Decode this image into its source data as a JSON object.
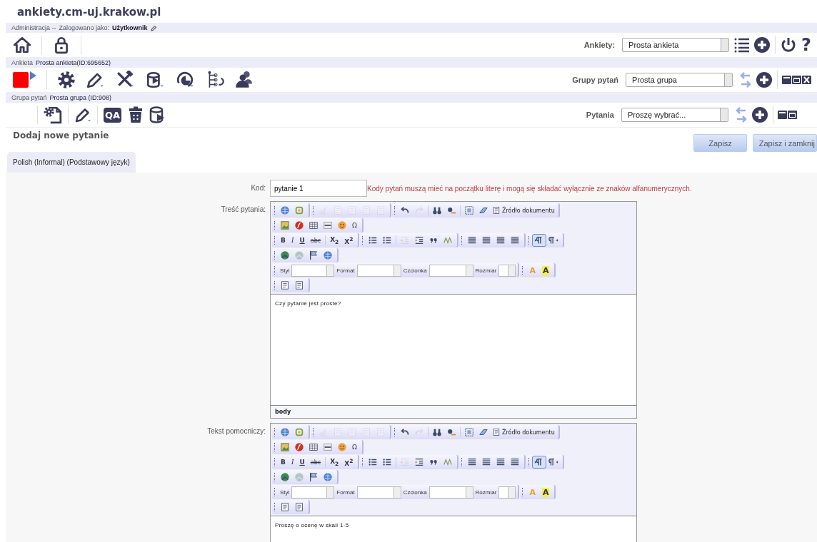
{
  "site_title": "ankiety.cm-uj.krakow.pl",
  "admin_bar": {
    "section": "Administracja --",
    "logged_as_label": "Zalogowano jako:",
    "user": "Użytkownik"
  },
  "main_toolbar": {
    "label": "Ankiety:",
    "select_value": "Prosta ankieta",
    "help": "?"
  },
  "survey_bar": {
    "label": "Ankieta",
    "value": "Prosta ankieta(ID:695652)"
  },
  "survey_toolbar": {
    "label": "Grupy pytań",
    "select_value": "Prosta grupa"
  },
  "group_bar": {
    "label": "Grupa pytań",
    "value": "Prosta grupa (ID:908)"
  },
  "group_toolbar": {
    "qa": "QA",
    "label": "Pytania",
    "select_value": "Proszę wybrać..."
  },
  "page_title": "Dodaj nowe pytanie",
  "buttons": [
    "Zapisz",
    "Zapisz i zamknij"
  ],
  "tabs": [
    {
      "label": "Polish (Informal) (Podstawowy język)",
      "selected": true
    }
  ],
  "form": {
    "code": {
      "label": "Kod:",
      "value": "pytanie 1",
      "error": "Kody pytań muszą mieć na początku literę i mogą się składać wyłącznie ze znaków alfanumerycznych."
    },
    "editors": [
      {
        "label": "Treść pytania:",
        "content": "Czy pytanie jest proste?",
        "path": "body",
        "toolbar": [
          [
            [
              {
                "kind": "icon",
                "disabled": false,
                "active": false
              },
              {
                "kind": "icon",
                "disabled": false,
                "active": false
              }
            ],
            [
              {
                "kind": "icon",
                "disabled": true,
                "active": false
              },
              {
                "kind": "icon",
                "disabled": true,
                "active": false
              },
              {
                "kind": "icon",
                "disabled": true,
                "active": false
              },
              {
                "kind": "icon",
                "disabled": true,
                "active": false
              },
              {
                "kind": "icon",
                "disabled": true,
                "active": false
              }
            ],
            [
              {
                "kind": "icon",
                "disabled": false,
                "active": false
              },
              {
                "kind": "icon",
                "disabled": true,
                "active": false
              },
              {
                "kind": "separator"
              },
              {
                "kind": "icon",
                "disabled": false,
                "active": false
              },
              {
                "kind": "icon",
                "disabled": false,
                "active": false
              },
              {
                "kind": "separator"
              },
              {
                "kind": "icon",
                "disabled": false,
                "active": false
              },
              {
                "kind": "icon",
                "disabled": false,
                "active": false
              },
              {
                "kind": "source",
                "label": "Źródło dokumentu"
              }
            ]
          ],
          [
            [
              {
                "kind": "icon",
                "disabled": false,
                "active": false
              },
              {
                "kind": "icon",
                "disabled": false,
                "active": false
              },
              {
                "kind": "icon",
                "disabled": false,
                "active": false
              },
              {
                "kind": "icon",
                "disabled": false,
                "active": false
              },
              {
                "kind": "icon",
                "disabled": false,
                "active": false
              },
              {
                "kind": "symbol",
                "label": "Ω"
              }
            ]
          ],
          [
            [
              {
                "kind": "bold",
                "label": "B"
              },
              {
                "kind": "italic",
                "label": "I"
              },
              {
                "kind": "underline",
                "label": "U"
              },
              {
                "kind": "strike",
                "label": "abc"
              },
              {
                "kind": "separator"
              },
              {
                "kind": "bold",
                "label": "X$_{2}$"
              },
              {
                "kind": "bold",
                "label": "X$^{2}$"
              }
            ],
            [
              {
                "kind": "icon",
                "disabled": false,
                "active": false
              },
              {
                "kind": "icon",
                "disabled": false,
                "active": false
              },
              {
                "kind": "separator"
              },
              {
                "kind": "icon",
                "disabled": true,
                "active": false
              },
              {
                "kind": "icon",
                "disabled": false,
                "active": false
              },
              {
                "kind": "icon",
                "disabled": false,
                "active": false
              },
              {
                "kind": "icon",
                "disabled": false,
                "active": false
              }
            ],
            [
              {
                "kind": "icon",
                "disabled": false,
                "active": false
              },
              {
                "kind": "icon",
                "disabled": false,
                "active": false
              },
              {
                "kind": "icon",
                "disabled": false,
                "active": false
              },
              {
                "kind": "icon",
                "disabled": false,
                "active": false
              }
            ],
            [
              {
                "kind": "icon",
                "disabled": false,
                "active": true
              },
              {
                "kind": "icon",
                "disabled": false,
                "active": false
              }
            ]
          ],
          [
            [
              {
                "kind": "icon",
                "disabled": false,
                "active": false
              },
              {
                "kind": "icon",
                "disabled": true,
                "active": false
              },
              {
                "kind": "icon",
                "disabled": false,
                "active": false
              },
              {
                "kind": "icon",
                "disabled": false,
                "active": false
              }
            ]
          ],
          [
            [
              {
                "kind": "select",
                "label": "Styl"
              },
              {
                "kind": "select",
                "label": "Format"
              },
              {
                "kind": "select",
                "label": "Czcionka"
              },
              {
                "kind": "select",
                "label": "Rozmiar"
              }
            ],
            [
              {
                "kind": "color",
                "label": "A",
                "highlight": false
              },
              {
                "kind": "color",
                "label": "A",
                "highlight": true
              }
            ]
          ],
          [
            [
              {
                "kind": "icon",
                "disabled": false,
                "active": false
              },
              {
                "kind": "icon",
                "disabled": false,
                "active": false
              }
            ]
          ]
        ]
      },
      {
        "label": "Tekst pomocniczy:",
        "content": "Proszę o ocenę w skali 1-5",
        "toolbar": [
          [
            [
              {
                "kind": "icon",
                "disabled": false,
                "active": false
              },
              {
                "kind": "icon",
                "disabled": false,
                "active": false
              }
            ],
            [
              {
                "kind": "icon",
                "disabled": true,
                "active": false
              },
              {
                "kind": "icon",
                "disabled": true,
                "active": false
              },
              {
                "kind": "icon",
                "disabled": true,
                "active": false
              },
              {
                "kind": "icon",
                "disabled": true,
                "active": false
              },
              {
                "kind": "icon",
                "disabled": true,
                "active": false
              }
            ],
            [
              {
                "kind": "icon",
                "disabled": false,
                "active": false
              },
              {
                "kind": "icon",
                "disabled": true,
                "active": false
              },
              {
                "kind": "separator"
              },
              {
                "kind": "icon",
                "disabled": false,
                "active": false
              },
              {
                "kind": "icon",
                "disabled": false,
                "active": false
              },
              {
                "kind": "separator"
              },
              {
                "kind": "icon",
                "disabled": false,
                "active": false
              },
              {
                "kind": "icon",
                "disabled": false,
                "active": false
              },
              {
                "kind": "source",
                "label": "Źródło dokumentu"
              }
            ]
          ],
          [
            [
              {
                "kind": "icon",
                "disabled": false,
                "active": false
              },
              {
                "kind": "icon",
                "disabled": false,
                "active": false
              },
              {
                "kind": "icon",
                "disabled": false,
                "active": false
              },
              {
                "kind": "icon",
                "disabled": false,
                "active": false
              },
              {
                "kind": "icon",
                "disabled": false,
                "active": false
              },
              {
                "kind": "symbol",
                "label": "Ω"
              }
            ]
          ],
          [
            [
              {
                "kind": "bold",
                "label": "B"
              },
              {
                "kind": "italic",
                "label": "I"
              },
              {
                "kind": "underline",
                "label": "U"
              },
              {
                "kind": "strike",
                "label": "abc"
              },
              {
                "kind": "separator"
              },
              {
                "kind": "bold",
                "label": "X$_{2}$"
              },
              {
                "kind": "bold",
                "label": "X$^{2}$"
              }
            ],
            [
              {
                "kind": "icon",
                "disabled": false,
                "active": false
              },
              {
                "kind": "icon",
                "disabled": false,
                "active": false
              },
              {
                "kind": "separator"
              },
              {
                "kind": "icon",
                "disabled": true,
                "active": false
              },
              {
                "kind": "icon",
                "disabled": false,
                "active": false
              },
              {
                "kind": "icon",
                "disabled": false,
                "active": false
              },
              {
                "kind": "icon",
                "disabled": false,
                "active": false
              }
            ],
            [
              {
                "kind": "icon",
                "disabled": false,
                "active": false
              },
              {
                "kind": "icon",
                "disabled": false,
                "active": false
              },
              {
                "kind": "icon",
                "disabled": false,
                "active": false
              },
              {
                "kind": "icon",
                "disabled": false,
                "active": false
              }
            ],
            [
              {
                "kind": "icon",
                "disabled": false,
                "active": true
              },
              {
                "kind": "icon",
                "disabled": false,
                "active": false
              }
            ]
          ],
          [
            [
              {
                "kind": "icon",
                "disabled": false,
                "active": false
              },
              {
                "kind": "icon",
                "disabled": true,
                "active": false
              },
              {
                "kind": "icon",
                "disabled": false,
                "active": false
              },
              {
                "kind": "icon",
                "disabled": false,
                "active": false
              }
            ]
          ],
          [
            [
              {
                "kind": "select",
                "label": "Styl"
              },
              {
                "kind": "select",
                "label": "Format"
              },
              {
                "kind": "select",
                "label": "Czcionka"
              },
              {
                "kind": "select",
                "label": "Rozmiar"
              }
            ],
            [
              {
                "kind": "color",
                "label": "A",
                "highlight": false
              },
              {
                "kind": "color",
                "label": "A",
                "highlight": true
              }
            ]
          ],
          [
            [
              {
                "kind": "icon",
                "disabled": false,
                "active": false
              },
              {
                "kind": "icon",
                "disabled": false,
                "active": false
              }
            ]
          ]
        ]
      }
    ]
  }
}
